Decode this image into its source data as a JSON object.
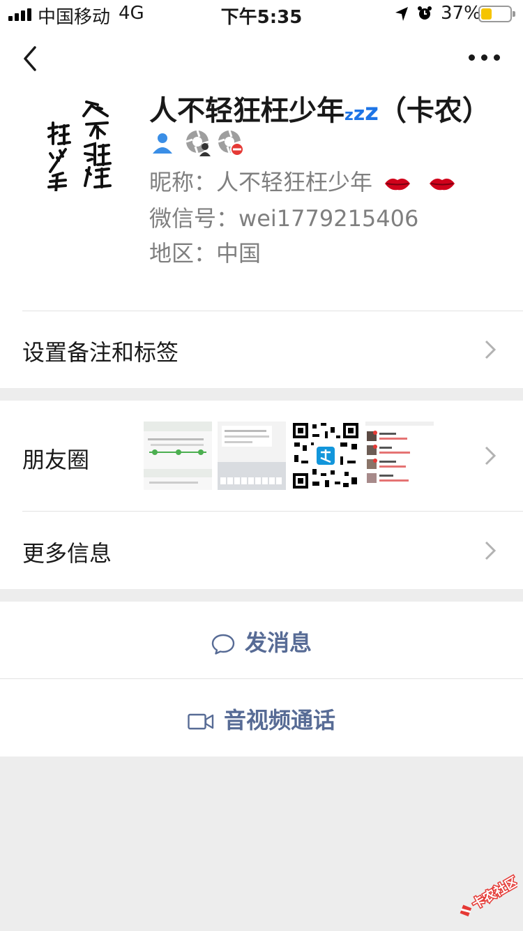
{
  "status_bar": {
    "carrier": "中国移动",
    "network": "4G",
    "time": "下午5:35",
    "battery_percent": "37%",
    "battery_level": 0.37,
    "battery_color": "#f5c400"
  },
  "nav": {
    "back_icon": "chevron-left-icon",
    "more_icon": "ellipsis-icon"
  },
  "profile": {
    "avatar_calligraphy": "人不轻狂枉少年",
    "display_name": "人不轻狂枉少年",
    "name_suffix": "（卡农）",
    "nickname_label": "昵称：",
    "nickname_value": "人不轻狂枉少年",
    "wechat_id_label": "微信号：",
    "wechat_id_value": "wei1779215406",
    "region_label": "地区：",
    "region_value": "中国"
  },
  "rows": {
    "remark": "设置备注和标签",
    "moments": "朋友圈",
    "more_info": "更多信息"
  },
  "actions": {
    "send_message": "发消息",
    "video_call": "音视频通话"
  },
  "colors": {
    "accent_link": "#576b95",
    "badge_blue": "#3a8ee6",
    "lips_red": "#d0021b"
  },
  "watermark": "卡农社区"
}
